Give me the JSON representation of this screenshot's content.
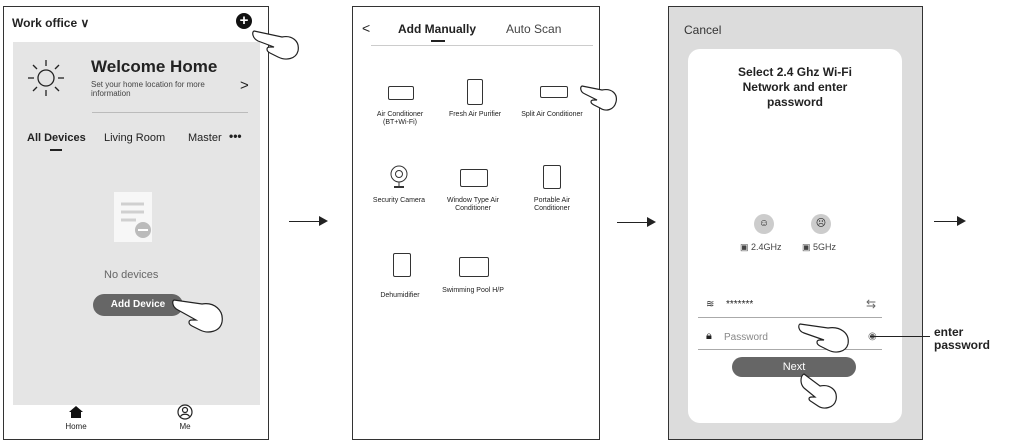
{
  "screen1": {
    "location": "Work office",
    "location_chevron": "∨",
    "add_glyph": "+",
    "welcome_title": "Welcome Home",
    "welcome_sub": "Set your home location for more information",
    "welcome_chevron": ">",
    "tabs": [
      "All Devices",
      "Living Room",
      "Master"
    ],
    "more": "•••",
    "empty_text": "No devices",
    "add_button": "Add Device",
    "nav": [
      "Home",
      "Me"
    ]
  },
  "screen2": {
    "back": "<",
    "tab_manual": "Add Manually",
    "tab_auto": "Auto Scan",
    "devices": [
      "Air Conditioner (BT+Wi-Fi)",
      "Fresh Air Purifier",
      "Split Air Conditioner",
      "Security Camera",
      "Window Type Air Conditioner",
      "Portable Air Conditioner",
      "Dehumidifier",
      "Swimming Pool H/P"
    ]
  },
  "screen3": {
    "cancel": "Cancel",
    "title": "Select 2.4 Ghz Wi-Fi Network and enter password",
    "freq_good": "2.4GHz",
    "freq_bad": "5GHz",
    "ssid": "*******",
    "password_placeholder": "Password",
    "next": "Next"
  },
  "annotation": "enter password"
}
